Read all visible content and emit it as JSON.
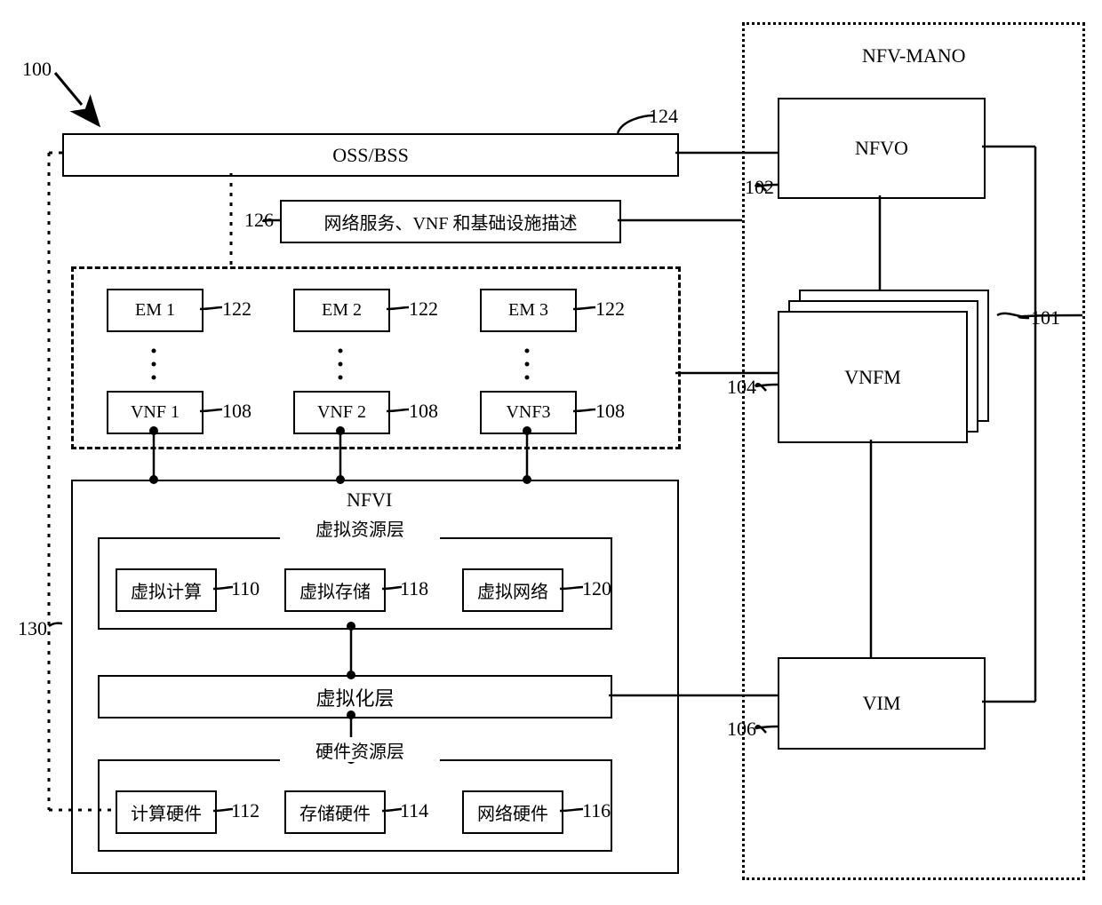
{
  "refs": {
    "overall": "100",
    "mano": "101",
    "nfvo": "102",
    "vnfm": "104",
    "vim": "106",
    "vnf": "108",
    "vcompute": "110",
    "hcompute": "112",
    "hstorage": "114",
    "hnetwork": "116",
    "vstorage": "118",
    "vnetwork": "120",
    "em": "122",
    "oss": "124",
    "desc": "126",
    "nfvi_line": "130"
  },
  "mano": {
    "title": "NFV-MANO",
    "nfvo": "NFVO",
    "vnfm": "VNFM",
    "vim": "VIM"
  },
  "oss_bss": "OSS/BSS",
  "desc_box": "网络服务、VNF 和基础设施描述",
  "em_vnf": {
    "em1": "EM 1",
    "em2": "EM 2",
    "em3": "EM 3",
    "vnf1": "VNF 1",
    "vnf2": "VNF 2",
    "vnf3": "VNF3"
  },
  "nfvi": {
    "title": "NFVI",
    "virtual_resource_layer": "虚拟资源层",
    "virtual_compute": "虚拟计算",
    "virtual_storage": "虚拟存储",
    "virtual_network": "虚拟网络",
    "virtualization_layer": "虚拟化层",
    "hardware_resource_layer": "硬件资源层",
    "compute_hw": "计算硬件",
    "storage_hw": "存储硬件",
    "network_hw": "网络硬件"
  }
}
